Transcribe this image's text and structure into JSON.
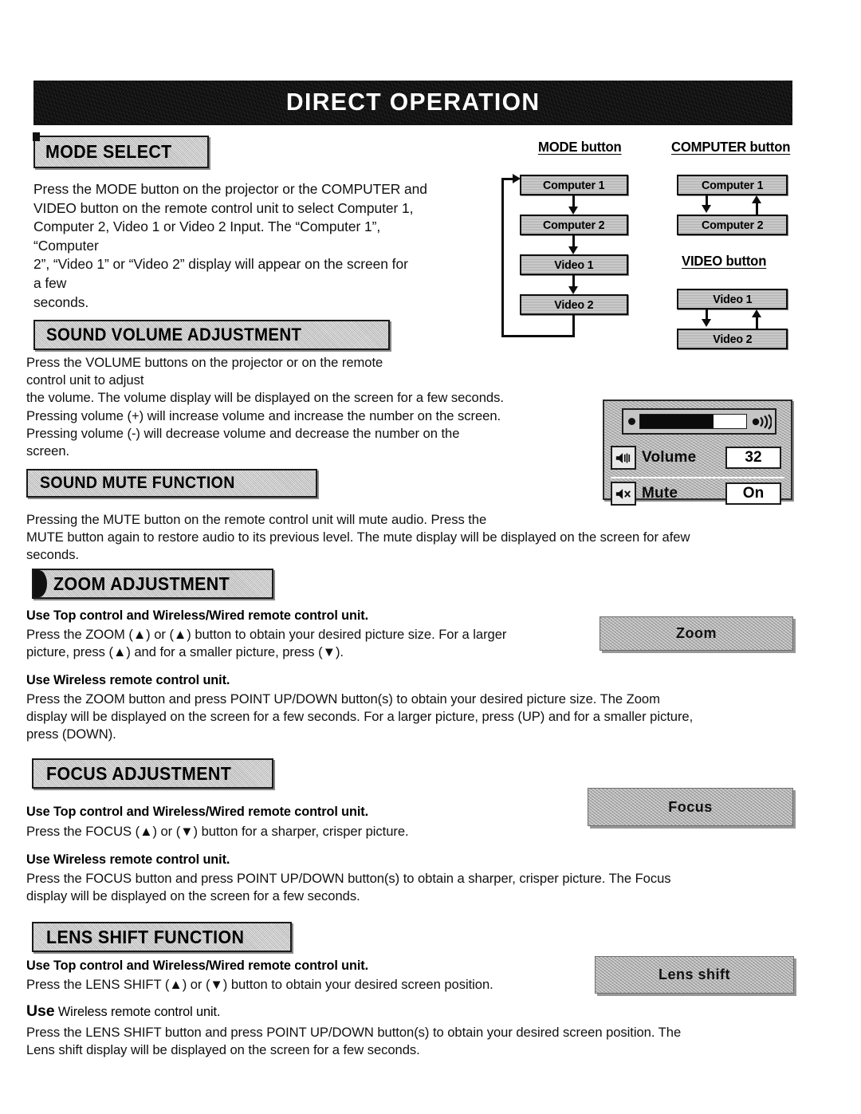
{
  "banner": {
    "title": "DIRECT OPERATION"
  },
  "sections": {
    "mode_select": {
      "heading": "MODE SELECT",
      "body": "Press the MODE button on the projector or the COMPUTER and\nVIDEO button on the remote control unit to select Computer 1,\nComputer 2, Video 1 or Video 2 Input. The “Computer 1”,\n“Computer\n2”, “Video 1” or “Video 2” display will appear on the screen for\na few\nseconds."
    },
    "sound_volume": {
      "heading": "SOUND VOLUME ADJUSTMENT",
      "body": "Press the VOLUME buttons on the projector or on the remote\ncontrol unit to adjust\nthe volume. The volume display will be displayed on the screen for a few seconds.\nPressing volume (+) will increase volume and increase the number on the screen.\nPressing volume (-) will decrease volume and decrease the number on the\nscreen."
    },
    "sound_mute": {
      "heading": "SOUND MUTE FUNCTION",
      "body": "Pressing the MUTE button on the remote control unit will mute audio. Press the\nMUTE button again to restore audio to its previous level. The mute display will be displayed on the screen for afew\nseconds."
    },
    "zoom": {
      "heading": "ZOOM ADJUSTMENT",
      "sub1": "Use Top control and Wireless/Wired remote control unit.",
      "body1": "Press the ZOOM (▲) or (▲) button to obtain your desired picture size. For a larger\npicture, press (▲) and for a smaller picture, press (▼).",
      "sub2": "Use Wireless remote control unit.",
      "body2": "Press the ZOOM button and press POINT UP/DOWN button(s) to obtain your desired picture size. The Zoom\ndisplay will be displayed on the screen for a few seconds. For a larger picture, press (UP) and for a smaller picture,\npress (DOWN)."
    },
    "focus": {
      "heading": "FOCUS ADJUSTMENT",
      "sub1": "Use Top control and Wireless/Wired remote control unit.",
      "body1": "Press the FOCUS (▲) or (▼) button for a sharper, crisper picture.",
      "sub2": "Use Wireless remote control unit.",
      "body2": "Press the FOCUS button and press POINT UP/DOWN button(s) to obtain a sharper, crisper picture. The Focus\ndisplay will be displayed on the screen for a few seconds."
    },
    "lens_shift": {
      "heading": "LENS SHIFT FUNCTION",
      "sub1": "Use Top control and Wireless/Wired remote control unit.",
      "body1": "Press the LENS SHIFT (▲) or (▼) button to obtain your desired screen position.",
      "sub2_lead": "Use",
      "sub2_rest": " Wireless remote control unit.",
      "body2": "Press the LENS SHIFT button and press POINT UP/DOWN button(s) to obtain your desired screen position. The\nLens shift display will be displayed on the screen for a few seconds."
    }
  },
  "diagram": {
    "mode_button_label": "MODE button",
    "computer_button_label": "COMPUTER button",
    "video_button_label": "VIDEO button",
    "mode_cycle": [
      "Computer 1",
      "Computer 2",
      "Video 1",
      "Video 2"
    ],
    "computer_toggle": [
      "Computer 1",
      "Computer 2"
    ],
    "video_toggle": [
      "Video 1",
      "Video 2"
    ]
  },
  "osd": {
    "volume_label": "Volume",
    "volume_value": "32",
    "mute_label": "Mute",
    "mute_value": "On",
    "bar_fill_percent": 69,
    "volume_icon": "speaker-icon",
    "mute_icon": "speaker-mute-icon",
    "buttons": {
      "zoom": "Zoom",
      "focus": "Focus",
      "lens_shift": "Lens shift"
    }
  },
  "colors": {
    "banner_bg": "#0d0d0d",
    "header_gray": "#c0c0c0",
    "box_gray": "#bdbdbd",
    "osd_gray": "#b9b9b9",
    "ink": "#101010"
  }
}
